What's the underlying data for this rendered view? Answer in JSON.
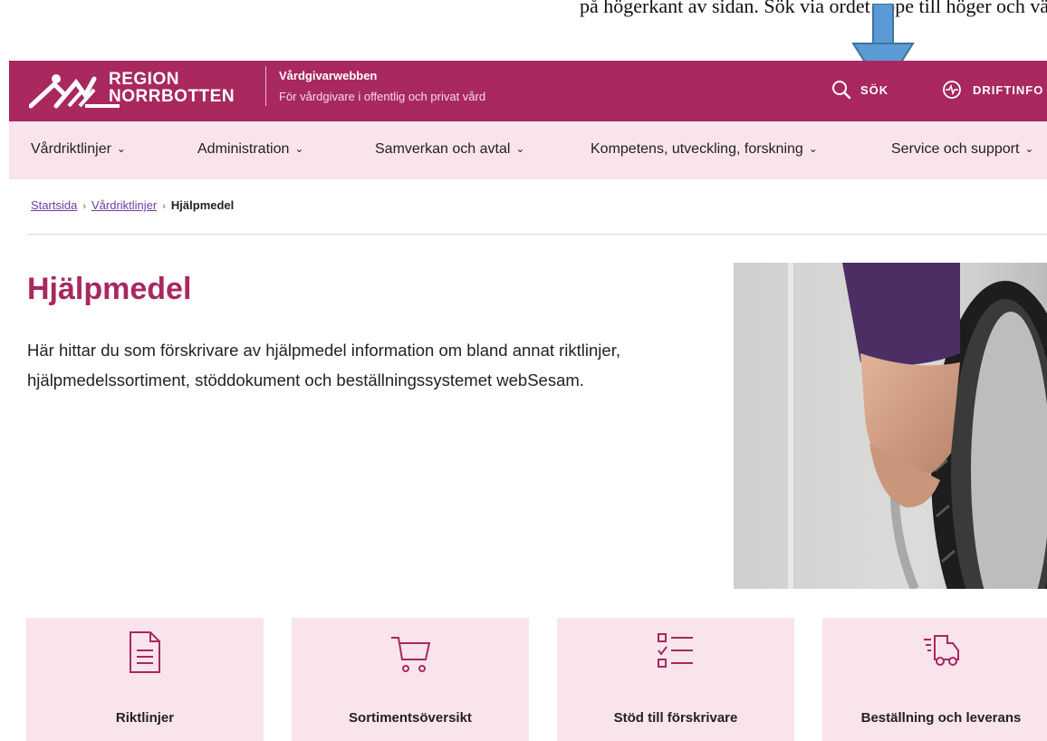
{
  "top_strip": {
    "clipped_text": "på högerkant av sidan. Sök via ordet uppe till höger och välj på"
  },
  "header": {
    "logo_line1": "REGION",
    "logo_line2": "NORRBOTTEN",
    "site_name": "Vårdgivarwebben",
    "site_subtitle": "För vårdgivare i offentlig och privat vård",
    "search_label": "SÖK",
    "driftinfo_label": "DRIFTINFO"
  },
  "nav": {
    "items": [
      {
        "label": "Vårdriktlinjer"
      },
      {
        "label": "Administration"
      },
      {
        "label": "Samverkan och avtal"
      },
      {
        "label": "Kompetens, utveckling, forskning"
      },
      {
        "label": "Service och support"
      }
    ]
  },
  "breadcrumb": {
    "items": [
      {
        "label": "Startsida"
      },
      {
        "label": "Vårdriktlinjer"
      }
    ],
    "current": "Hjälpmedel"
  },
  "main": {
    "title": "Hjälpmedel",
    "intro_line1": "Här hittar du som förskrivare av hjälpmedel information om bland annat riktlinjer,",
    "intro_line2": "hjälpmedelssortiment, stöddokument och beställningssystemet webSesam."
  },
  "cards": [
    {
      "label": "Riktlinjer",
      "icon": "document-icon"
    },
    {
      "label": "Sortimentsöversikt",
      "icon": "cart-icon"
    },
    {
      "label": "Stöd till förskrivare",
      "icon": "checklist-icon"
    },
    {
      "label": "Beställning och leverans",
      "icon": "delivery-truck-icon"
    }
  ],
  "colors": {
    "brand": "#a8285f",
    "nav_bg": "#f9e4ec",
    "arrow": "#5b9bd5"
  }
}
